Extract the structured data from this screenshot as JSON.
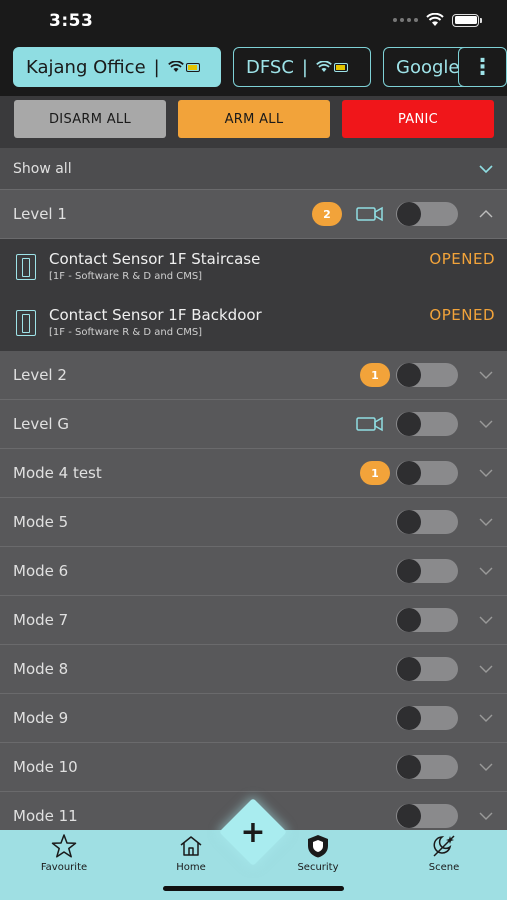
{
  "status_bar": {
    "time": "3:53"
  },
  "site_tabs": [
    {
      "name": "Kajang Office",
      "separator": "|",
      "active": true
    },
    {
      "name": "DFSC",
      "separator": "|",
      "active": false
    },
    {
      "name": "Google",
      "active": false
    }
  ],
  "menu": {
    "icon": "vertical-ellipsis-icon",
    "glyph": "⋮"
  },
  "actions": {
    "disarm_all": "DISARM ALL",
    "arm_all": "ARM ALL",
    "panic": "PANIC"
  },
  "filter": {
    "label": "Show all"
  },
  "zones": [
    {
      "label": "Level 1",
      "badge": "2",
      "camera": true,
      "expanded": true,
      "sensors": [
        {
          "name": "Contact Sensor 1F Staircase",
          "location": "[1F - Software R & D and CMS]",
          "state": "OPENED"
        },
        {
          "name": "Contact Sensor 1F Backdoor",
          "location": "[1F - Software R & D and CMS]",
          "state": "OPENED"
        }
      ]
    },
    {
      "label": "Level 2",
      "badge": "1",
      "camera": false
    },
    {
      "label": "Level G",
      "camera": true
    },
    {
      "label": "Mode 4 test",
      "badge": "1",
      "camera": false
    },
    {
      "label": "Mode 5"
    },
    {
      "label": "Mode 6"
    },
    {
      "label": "Mode 7"
    },
    {
      "label": "Mode 8"
    },
    {
      "label": "Mode 9"
    },
    {
      "label": "Mode 10"
    },
    {
      "label": "Mode 11"
    }
  ],
  "fab": {
    "glyph": "+"
  },
  "bottom_nav": [
    {
      "label": "Favourite",
      "icon": "star-icon"
    },
    {
      "label": "Home",
      "icon": "home-icon"
    },
    {
      "label": "Security",
      "icon": "shield-icon",
      "active": true
    },
    {
      "label": "Scene",
      "icon": "scene-icon"
    }
  ],
  "colors": {
    "accent": "#8fdde2",
    "arm": "#f2a33a",
    "panic": "#f0161a",
    "disarm": "#a8a8a8",
    "opened": "#f2a33a"
  }
}
